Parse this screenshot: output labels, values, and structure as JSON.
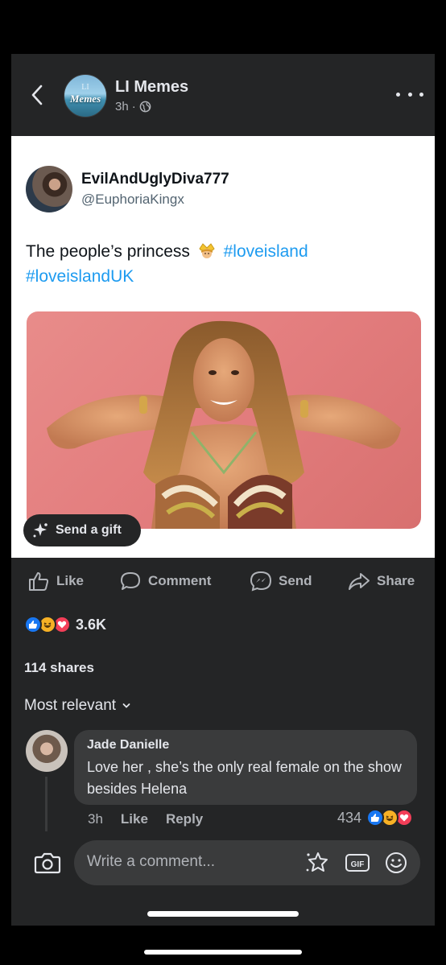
{
  "header": {
    "page_name": "LI Memes",
    "logo_li": "LI",
    "logo_text": "Memes",
    "time": "3h",
    "separator": "·",
    "icons": {
      "back": "chevron-left-icon",
      "privacy": "globe-icon",
      "more": "more-horizontal-icon"
    }
  },
  "tweet": {
    "display_name": "EvilAndUglyDiva777",
    "handle": "@EuphoriaKingx",
    "text": "The people’s princess",
    "emoji": "princess-crown-icon",
    "hashtag1": "#loveisland",
    "hashtag2": "#loveislandUK"
  },
  "gift": {
    "label": "Send a gift",
    "icon": "gift-sparkle-icon"
  },
  "actions": {
    "like": "Like",
    "comment": "Comment",
    "send": "Send",
    "share": "Share"
  },
  "reactions": {
    "count": "3.6K",
    "types": [
      "like",
      "haha",
      "love"
    ],
    "colors": {
      "like": "#1877f2",
      "haha": "#f7b125",
      "love": "#f33e58"
    }
  },
  "shares_text": "114 shares",
  "sort_label": "Most relevant",
  "comment": {
    "author": "Jade Danielle",
    "text": "Love her , she’s the only real female on the show besides Helena",
    "time": "3h",
    "like": "Like",
    "reply": "Reply",
    "reaction_count": "434"
  },
  "composer": {
    "placeholder": "Write a comment...",
    "gif_label": "GIF"
  },
  "colors": {
    "background": "#242526",
    "bubble": "#3a3b3c",
    "hashtag": "#1d9bf0",
    "secondary_text": "#b0b3b8"
  }
}
